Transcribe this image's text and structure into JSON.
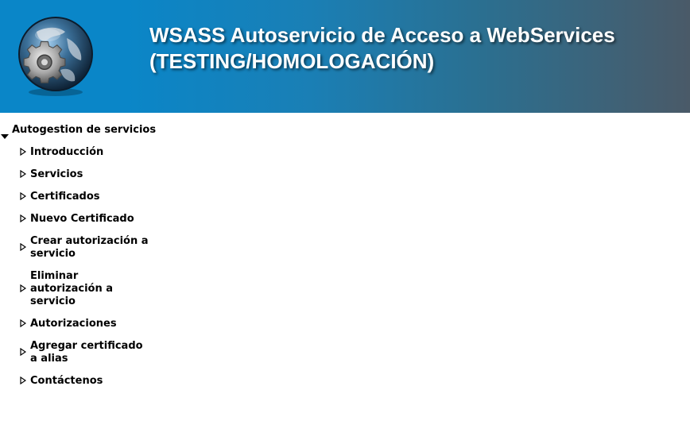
{
  "header": {
    "title_line1": "WSASS Autoservicio de Acceso a WebServices",
    "title_line2": "(TESTING/HOMOLOGACIÓN)",
    "logo_icon": "globe-gear-logo-icon",
    "gradient_start": "#0a86c8",
    "gradient_end": "#4a5a68"
  },
  "sidebar": {
    "group_label": "Autogestion de servicios",
    "items": [
      {
        "label": "Introducción"
      },
      {
        "label": "Servicios"
      },
      {
        "label": "Certificados"
      },
      {
        "label": "Nuevo Certificado"
      },
      {
        "label": "Crear autorización a servicio"
      },
      {
        "label": "Eliminar autorización a servicio"
      },
      {
        "label": "Autorizaciones"
      },
      {
        "label": "Agregar certificado a alias"
      },
      {
        "label": "Contáctenos"
      }
    ]
  }
}
